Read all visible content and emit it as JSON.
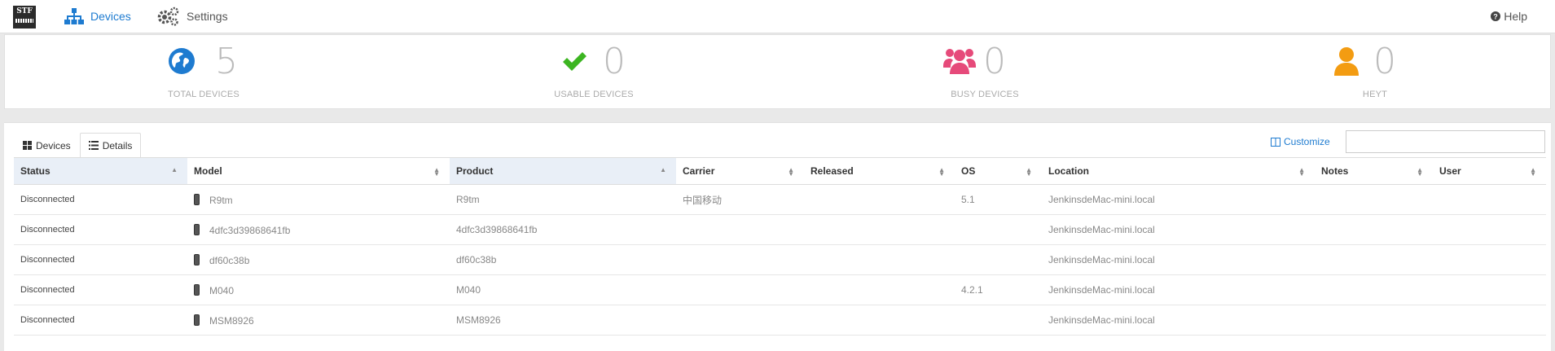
{
  "nav": {
    "logo_text": "STF",
    "devices_label": "Devices",
    "settings_label": "Settings",
    "help_label": "Help"
  },
  "stats": [
    {
      "number": "5",
      "label": "TOTAL DEVICES",
      "icon": "globe-icon",
      "color": "#1e7bd0"
    },
    {
      "number": "0",
      "label": "USABLE DEVICES",
      "icon": "check-icon",
      "color": "#3cb521"
    },
    {
      "number": "0",
      "label": "BUSY DEVICES",
      "icon": "users-icon",
      "color": "#e64a7a"
    },
    {
      "number": "0",
      "label": "HEYT",
      "icon": "user-icon",
      "color": "#f39c12"
    }
  ],
  "tabs": {
    "devices_label": "Devices",
    "details_label": "Details"
  },
  "customize_label": "Customize",
  "filter": {
    "value": "",
    "placeholder": ""
  },
  "table": {
    "columns": [
      "Status",
      "Model",
      "Product",
      "Carrier",
      "Released",
      "OS",
      "Location",
      "Notes",
      "User"
    ],
    "rows": [
      {
        "status": "Disconnected",
        "model": "R9tm",
        "product": "R9tm",
        "carrier": "中国移动",
        "released": "",
        "os": "5.1",
        "location": "JenkinsdeMac-mini.local",
        "notes": "",
        "user": ""
      },
      {
        "status": "Disconnected",
        "model": "4dfc3d39868641fb",
        "product": "4dfc3d39868641fb",
        "carrier": "",
        "released": "",
        "os": "",
        "location": "JenkinsdeMac-mini.local",
        "notes": "",
        "user": ""
      },
      {
        "status": "Disconnected",
        "model": "df60c38b",
        "product": "df60c38b",
        "carrier": "",
        "released": "",
        "os": "",
        "location": "JenkinsdeMac-mini.local",
        "notes": "",
        "user": ""
      },
      {
        "status": "Disconnected",
        "model": "M040",
        "product": "M040",
        "carrier": "",
        "released": "",
        "os": "4.2.1",
        "location": "JenkinsdeMac-mini.local",
        "notes": "",
        "user": ""
      },
      {
        "status": "Disconnected",
        "model": "MSM8926",
        "product": "MSM8926",
        "carrier": "",
        "released": "",
        "os": "",
        "location": "JenkinsdeMac-mini.local",
        "notes": "",
        "user": ""
      }
    ]
  }
}
